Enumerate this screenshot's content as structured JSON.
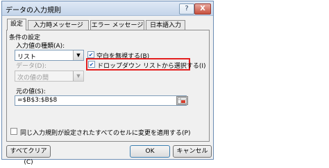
{
  "window": {
    "title": "データの入力規則",
    "help": "?",
    "close": "X"
  },
  "tabs": [
    {
      "label": "設定"
    },
    {
      "label": "入力時メッセージ"
    },
    {
      "label": "エラー メッセージ"
    },
    {
      "label": "日本語入力"
    }
  ],
  "settings": {
    "group_label": "条件の設定",
    "allow_label": "入力値の種類(A):",
    "allow_value": "リスト",
    "data_label": "データ(D):",
    "data_value": "次の値の間",
    "ignore_blank": {
      "label": "空白を無視する(B)",
      "checked": true
    },
    "dropdown": {
      "label": "ドロップダウン リストから選択する(I)",
      "checked": true
    },
    "source_label": "元の値(S):",
    "source_value": "=$B$3:$B$8",
    "apply_all": {
      "label": "同じ入力規則が設定されたすべてのセルに変更を適用する(P)",
      "checked": false
    }
  },
  "buttons": {
    "clear_all": "すべてクリア(C)",
    "ok": "OK",
    "cancel": "キャンセル"
  },
  "colors": {
    "highlight": "#e41e1e",
    "accent": "#6b8cb4"
  }
}
